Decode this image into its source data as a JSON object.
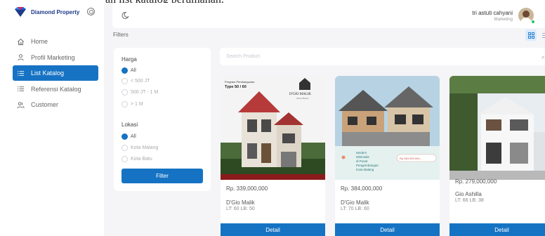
{
  "top_clip_text": "ah list katalog perumahan.",
  "brand": {
    "name": "Diamond Property"
  },
  "nav": [
    {
      "label": "Home"
    },
    {
      "label": "Profil Marketing"
    },
    {
      "label": "List Katalog"
    },
    {
      "label": "Referensi Katalog"
    },
    {
      "label": "Customer"
    }
  ],
  "user": {
    "name": "tri astuti cahyani",
    "role": "Marketing"
  },
  "filters_label": "Filters",
  "filter_panel": {
    "harga_title": "Harga",
    "harga_options": [
      "All",
      "< 500 JT",
      "500 JT - 1 M",
      "> 1 M"
    ],
    "lokasi_title": "Lokasi",
    "lokasi_options": [
      "All",
      "Kota Malang",
      "Kota Batu"
    ],
    "button": "Filter"
  },
  "search": {
    "placeholder": "Search Product"
  },
  "products": [
    {
      "price": "Rp. 339,000,000",
      "title": "D'Gio Malik",
      "spec": "LT: 60 LB: 50",
      "button": "Detail",
      "img_caption_1": "Program Pembangunan",
      "img_caption_2": "Type 50 / 60",
      "img_brand": "D'GIO MALIK",
      "img_tag": "Town House"
    },
    {
      "price": "Rp. 384,000,000",
      "title": "D'Gio Malik",
      "spec": "LT: 70 LB: 60",
      "button": "Detail",
      "img_lines": [
        "Modern",
        "Minimalis",
        "di Pusat",
        "Pengembangan",
        "Kota Malang"
      ],
      "img_price": "Rp.384.000.000,-"
    },
    {
      "price": "Rp. 279,000,000",
      "title": "Gio Ashilla",
      "spec": "LT: 66 LB: 38",
      "button": "Detail"
    }
  ],
  "colors": {
    "primary": "#1673c4",
    "brand": "#1e3a8a",
    "background": "#f5f5f7"
  }
}
